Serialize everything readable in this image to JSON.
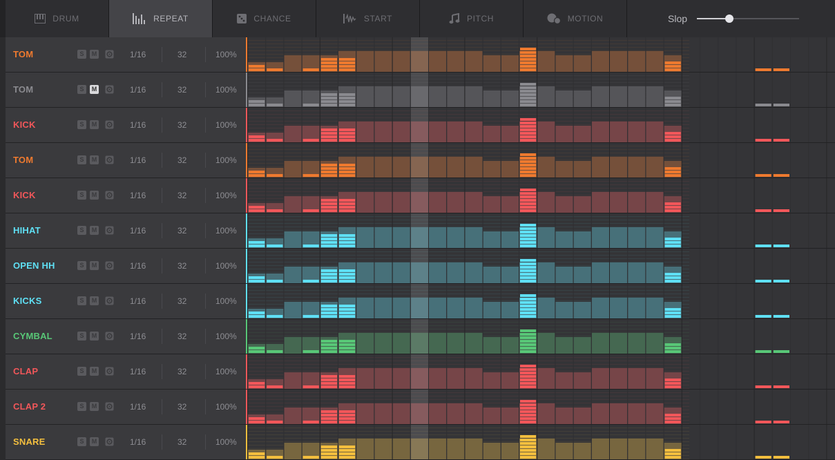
{
  "tabs": [
    {
      "label": "DRUM",
      "icon": "drum-keys-icon",
      "active": false
    },
    {
      "label": "REPEAT",
      "icon": "repeat-bars-icon",
      "active": true
    },
    {
      "label": "CHANCE",
      "icon": "dice-icon",
      "active": false
    },
    {
      "label": "START",
      "icon": "start-wave-icon",
      "active": false
    },
    {
      "label": "PITCH",
      "icon": "music-note-icon",
      "active": false
    },
    {
      "label": "MOTION",
      "icon": "motion-icon",
      "active": false
    }
  ],
  "slop": {
    "label": "Slop",
    "value": 0.32
  },
  "colors": {
    "orange": "#ee7a2f",
    "red": "#f2575a",
    "cyan": "#5fe0f5",
    "green": "#58c777",
    "yellow": "#f4bf3e",
    "gray": "#8a8a8f"
  },
  "step_repeats": [
    2,
    1,
    0,
    1,
    4,
    4,
    0,
    0,
    0,
    0,
    0,
    0,
    0,
    0,
    0,
    7,
    0,
    0,
    0,
    0,
    0,
    0,
    0,
    3,
    0,
    0,
    0,
    0,
    1,
    1,
    0,
    0
  ],
  "tracks": [
    {
      "name": "TOM",
      "color": "#ee7a2f",
      "mute": false,
      "rate": "1/16",
      "length": "32",
      "chance": "100%"
    },
    {
      "name": "TOM",
      "color": "#8a8a8f",
      "mute": true,
      "rate": "1/16",
      "length": "32",
      "chance": "100%"
    },
    {
      "name": "KICK",
      "color": "#f2575a",
      "mute": false,
      "rate": "1/16",
      "length": "32",
      "chance": "100%"
    },
    {
      "name": "TOM",
      "color": "#ee7a2f",
      "mute": false,
      "rate": "1/16",
      "length": "32",
      "chance": "100%"
    },
    {
      "name": "KICK",
      "color": "#f2575a",
      "mute": false,
      "rate": "1/16",
      "length": "32",
      "chance": "100%"
    },
    {
      "name": "HIHAT",
      "color": "#5fe0f5",
      "mute": false,
      "rate": "1/16",
      "length": "32",
      "chance": "100%"
    },
    {
      "name": "OPEN HH",
      "color": "#5fe0f5",
      "mute": false,
      "rate": "1/16",
      "length": "32",
      "chance": "100%"
    },
    {
      "name": "KICKS",
      "color": "#5fe0f5",
      "mute": false,
      "rate": "1/16",
      "length": "32",
      "chance": "100%"
    },
    {
      "name": "CYMBAL",
      "color": "#58c777",
      "mute": false,
      "rate": "1/16",
      "length": "32",
      "chance": "100%"
    },
    {
      "name": "CLAP",
      "color": "#f2575a",
      "mute": false,
      "rate": "1/16",
      "length": "32",
      "chance": "100%"
    },
    {
      "name": "CLAP 2",
      "color": "#f2575a",
      "mute": false,
      "rate": "1/16",
      "length": "32",
      "chance": "100%"
    },
    {
      "name": "SNARE",
      "color": "#f4bf3e",
      "mute": false,
      "rate": "1/16",
      "length": "32",
      "chance": "100%"
    }
  ],
  "buttons": {
    "solo": "S",
    "mute": "M"
  }
}
